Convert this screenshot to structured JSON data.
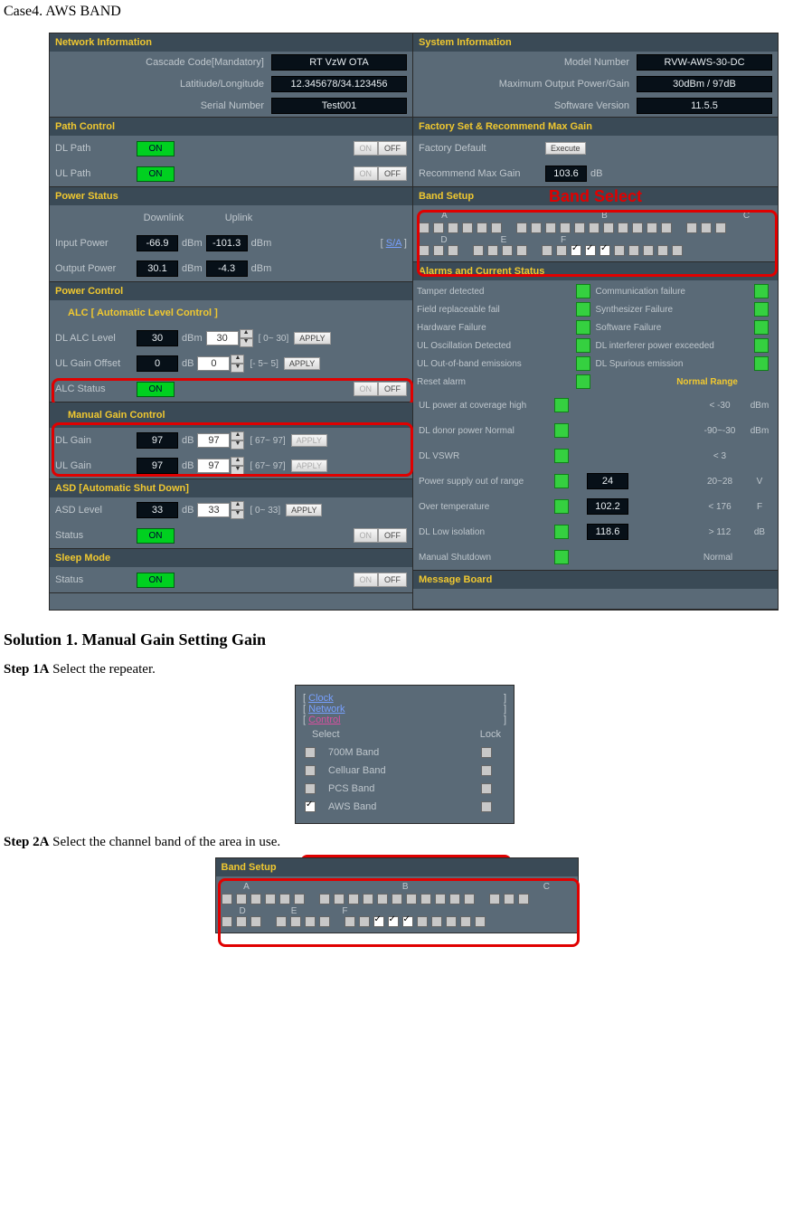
{
  "case": {
    "title": "Case4. AWS BAND"
  },
  "net": {
    "hdr": "Network Information",
    "cascade_l": "Cascade Code[Mandatory]",
    "cascade_v": "RT VzW OTA",
    "ll_l": "Latitiude/Longitude",
    "ll_v": "12.345678/34.123456",
    "sn_l": "Serial Number",
    "sn_v": "Test001"
  },
  "sys": {
    "hdr": "System Information",
    "model_l": "Model Number",
    "model_v": "RVW-AWS-30-DC",
    "mop_l": "Maximum Output Power/Gain",
    "mop_v": "30dBm / 97dB",
    "sw_l": "Software Version",
    "sw_v": "11.5.5"
  },
  "path": {
    "hdr": "Path Control",
    "dl_l": "DL Path",
    "ul_l": "UL Path",
    "on": "ON",
    "off": "OFF"
  },
  "fact": {
    "hdr": "Factory Set & Recommend Max Gain",
    "fd_l": "Factory Default",
    "exec": "Execute",
    "rmg_l": "Recommend Max Gain",
    "rmg_v": "103.6",
    "db": "dB"
  },
  "ps": {
    "hdr": "Power Status",
    "dl": "Downlink",
    "ul": "Uplink",
    "ip_l": "Input Power",
    "ip_dl": "-66.9",
    "ip_ul": "-101.3",
    "op_l": "Output Power",
    "op_dl": "30.1",
    "op_ul": "-4.3",
    "dbm": "dBm",
    "sa": "S/A"
  },
  "bs": {
    "hdr": "Band Setup",
    "annot": "Band Select",
    "A": "A",
    "B": "B",
    "C": "C",
    "D": "D",
    "E": "E",
    "F": "F"
  },
  "pc": {
    "hdr": "Power Control",
    "alc_h": "ALC [ Automatic Level Control ]",
    "dl_alc_l": "DL ALC Level",
    "dl_alc_v": "30",
    "dbm": "dBm",
    "dl_alc_sp": "30",
    "dl_alc_r": "[ 0~ 30]",
    "ul_off_l": "UL Gain Offset",
    "ul_off_v": "0",
    "db": "dB",
    "ul_off_sp": "0",
    "ul_off_r": "[- 5~  5]",
    "alc_st_l": "ALC Status",
    "apply": "APPLY",
    "on": "ON",
    "off": "OFF"
  },
  "mgc": {
    "hdr": "Manual Gain Control",
    "dl_l": "DL Gain",
    "dl_v": "97",
    "dl_sp": "97",
    "dl_r": "[ 67~ 97]",
    "ul_l": "UL Gain",
    "ul_v": "97",
    "ul_sp": "97",
    "ul_r": "[ 67~ 97]",
    "db": "dB",
    "apply": "APPLY"
  },
  "asd": {
    "hdr": "ASD [Automatic Shut Down]",
    "lvl_l": "ASD Level",
    "lvl_v": "33",
    "lvl_sp": "33",
    "lvl_r": "[ 0~ 33]",
    "db": "dB",
    "st_l": "Status",
    "apply": "APPLY",
    "on": "ON",
    "off": "OFF"
  },
  "sleep": {
    "hdr": "Sleep Mode",
    "st_l": "Status",
    "on": "ON",
    "off": "OFF"
  },
  "alm": {
    "hdr": "Alarms and Current Status",
    "i": [
      "Tamper detected",
      "Communication failure",
      "Field replaceable fail",
      "Synthesizer Failure",
      "Hardware Failure",
      "Software Failure",
      "UL Oscillation Detected",
      "DL interferer power exceeded",
      "UL Out-of-band emissions",
      "DL Spurious emission",
      "Reset alarm"
    ],
    "nr": "Normal Range",
    "rows": [
      {
        "l": "UL power at coverage high",
        "v": "",
        "r": "< -30",
        "u": "dBm"
      },
      {
        "l": "DL donor power Normal",
        "v": "",
        "r": "-90~-30",
        "u": "dBm"
      },
      {
        "l": "DL VSWR",
        "v": "",
        "r": "< 3",
        "u": ""
      },
      {
        "l": "Power supply out of range",
        "v": "24",
        "r": "20~28",
        "u": "V"
      },
      {
        "l": "Over temperature",
        "v": "102.2",
        "r": "< 176",
        "u": "F"
      },
      {
        "l": "DL Low isolation",
        "v": "118.6",
        "r": "> 112",
        "u": "dB"
      }
    ],
    "ms_l": "Manual Shutdown",
    "ms_v": "Normal"
  },
  "msg": {
    "hdr": "Message Board"
  },
  "sol": {
    "title": "Solution 1. Manual Gain Setting Gain"
  },
  "s1": {
    "label": "Step 1A",
    "txt": " Select the repeater."
  },
  "sel": {
    "clock": "Clock",
    "network": "Network",
    "control": "Control",
    "sel": "Select",
    "lock": "Lock",
    "b700": "700M Band",
    "cell": "Celluar Band",
    "pcs": "PCS Band",
    "aws": "AWS Band"
  },
  "s2": {
    "label": "Step 2A",
    "txt": " Select the channel band of the area in use."
  }
}
